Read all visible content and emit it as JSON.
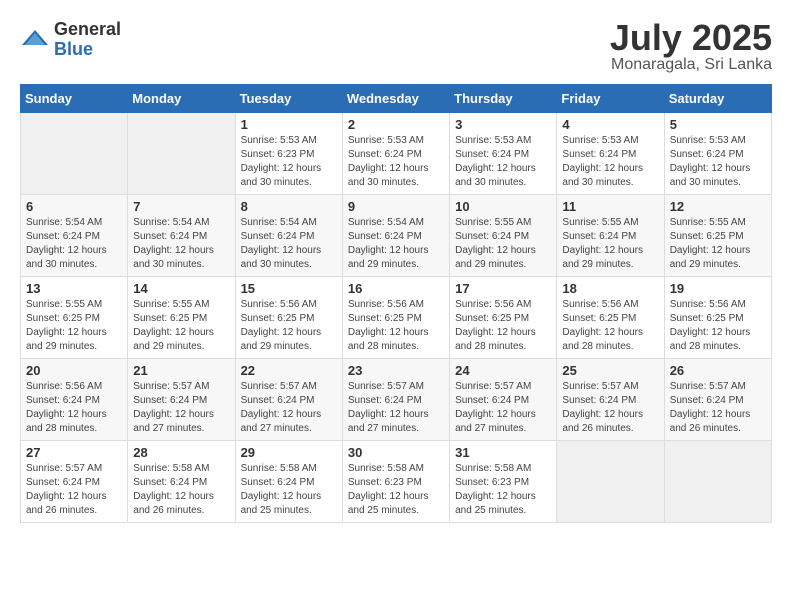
{
  "logo": {
    "general": "General",
    "blue": "Blue"
  },
  "title": "July 2025",
  "location": "Monaragala, Sri Lanka",
  "days_header": [
    "Sunday",
    "Monday",
    "Tuesday",
    "Wednesday",
    "Thursday",
    "Friday",
    "Saturday"
  ],
  "weeks": [
    [
      {
        "day": "",
        "sunrise": "",
        "sunset": "",
        "daylight": ""
      },
      {
        "day": "",
        "sunrise": "",
        "sunset": "",
        "daylight": ""
      },
      {
        "day": "1",
        "sunrise": "Sunrise: 5:53 AM",
        "sunset": "Sunset: 6:23 PM",
        "daylight": "Daylight: 12 hours and 30 minutes."
      },
      {
        "day": "2",
        "sunrise": "Sunrise: 5:53 AM",
        "sunset": "Sunset: 6:24 PM",
        "daylight": "Daylight: 12 hours and 30 minutes."
      },
      {
        "day": "3",
        "sunrise": "Sunrise: 5:53 AM",
        "sunset": "Sunset: 6:24 PM",
        "daylight": "Daylight: 12 hours and 30 minutes."
      },
      {
        "day": "4",
        "sunrise": "Sunrise: 5:53 AM",
        "sunset": "Sunset: 6:24 PM",
        "daylight": "Daylight: 12 hours and 30 minutes."
      },
      {
        "day": "5",
        "sunrise": "Sunrise: 5:53 AM",
        "sunset": "Sunset: 6:24 PM",
        "daylight": "Daylight: 12 hours and 30 minutes."
      }
    ],
    [
      {
        "day": "6",
        "sunrise": "Sunrise: 5:54 AM",
        "sunset": "Sunset: 6:24 PM",
        "daylight": "Daylight: 12 hours and 30 minutes."
      },
      {
        "day": "7",
        "sunrise": "Sunrise: 5:54 AM",
        "sunset": "Sunset: 6:24 PM",
        "daylight": "Daylight: 12 hours and 30 minutes."
      },
      {
        "day": "8",
        "sunrise": "Sunrise: 5:54 AM",
        "sunset": "Sunset: 6:24 PM",
        "daylight": "Daylight: 12 hours and 30 minutes."
      },
      {
        "day": "9",
        "sunrise": "Sunrise: 5:54 AM",
        "sunset": "Sunset: 6:24 PM",
        "daylight": "Daylight: 12 hours and 29 minutes."
      },
      {
        "day": "10",
        "sunrise": "Sunrise: 5:55 AM",
        "sunset": "Sunset: 6:24 PM",
        "daylight": "Daylight: 12 hours and 29 minutes."
      },
      {
        "day": "11",
        "sunrise": "Sunrise: 5:55 AM",
        "sunset": "Sunset: 6:24 PM",
        "daylight": "Daylight: 12 hours and 29 minutes."
      },
      {
        "day": "12",
        "sunrise": "Sunrise: 5:55 AM",
        "sunset": "Sunset: 6:25 PM",
        "daylight": "Daylight: 12 hours and 29 minutes."
      }
    ],
    [
      {
        "day": "13",
        "sunrise": "Sunrise: 5:55 AM",
        "sunset": "Sunset: 6:25 PM",
        "daylight": "Daylight: 12 hours and 29 minutes."
      },
      {
        "day": "14",
        "sunrise": "Sunrise: 5:55 AM",
        "sunset": "Sunset: 6:25 PM",
        "daylight": "Daylight: 12 hours and 29 minutes."
      },
      {
        "day": "15",
        "sunrise": "Sunrise: 5:56 AM",
        "sunset": "Sunset: 6:25 PM",
        "daylight": "Daylight: 12 hours and 29 minutes."
      },
      {
        "day": "16",
        "sunrise": "Sunrise: 5:56 AM",
        "sunset": "Sunset: 6:25 PM",
        "daylight": "Daylight: 12 hours and 28 minutes."
      },
      {
        "day": "17",
        "sunrise": "Sunrise: 5:56 AM",
        "sunset": "Sunset: 6:25 PM",
        "daylight": "Daylight: 12 hours and 28 minutes."
      },
      {
        "day": "18",
        "sunrise": "Sunrise: 5:56 AM",
        "sunset": "Sunset: 6:25 PM",
        "daylight": "Daylight: 12 hours and 28 minutes."
      },
      {
        "day": "19",
        "sunrise": "Sunrise: 5:56 AM",
        "sunset": "Sunset: 6:25 PM",
        "daylight": "Daylight: 12 hours and 28 minutes."
      }
    ],
    [
      {
        "day": "20",
        "sunrise": "Sunrise: 5:56 AM",
        "sunset": "Sunset: 6:24 PM",
        "daylight": "Daylight: 12 hours and 28 minutes."
      },
      {
        "day": "21",
        "sunrise": "Sunrise: 5:57 AM",
        "sunset": "Sunset: 6:24 PM",
        "daylight": "Daylight: 12 hours and 27 minutes."
      },
      {
        "day": "22",
        "sunrise": "Sunrise: 5:57 AM",
        "sunset": "Sunset: 6:24 PM",
        "daylight": "Daylight: 12 hours and 27 minutes."
      },
      {
        "day": "23",
        "sunrise": "Sunrise: 5:57 AM",
        "sunset": "Sunset: 6:24 PM",
        "daylight": "Daylight: 12 hours and 27 minutes."
      },
      {
        "day": "24",
        "sunrise": "Sunrise: 5:57 AM",
        "sunset": "Sunset: 6:24 PM",
        "daylight": "Daylight: 12 hours and 27 minutes."
      },
      {
        "day": "25",
        "sunrise": "Sunrise: 5:57 AM",
        "sunset": "Sunset: 6:24 PM",
        "daylight": "Daylight: 12 hours and 26 minutes."
      },
      {
        "day": "26",
        "sunrise": "Sunrise: 5:57 AM",
        "sunset": "Sunset: 6:24 PM",
        "daylight": "Daylight: 12 hours and 26 minutes."
      }
    ],
    [
      {
        "day": "27",
        "sunrise": "Sunrise: 5:57 AM",
        "sunset": "Sunset: 6:24 PM",
        "daylight": "Daylight: 12 hours and 26 minutes."
      },
      {
        "day": "28",
        "sunrise": "Sunrise: 5:58 AM",
        "sunset": "Sunset: 6:24 PM",
        "daylight": "Daylight: 12 hours and 26 minutes."
      },
      {
        "day": "29",
        "sunrise": "Sunrise: 5:58 AM",
        "sunset": "Sunset: 6:24 PM",
        "daylight": "Daylight: 12 hours and 25 minutes."
      },
      {
        "day": "30",
        "sunrise": "Sunrise: 5:58 AM",
        "sunset": "Sunset: 6:23 PM",
        "daylight": "Daylight: 12 hours and 25 minutes."
      },
      {
        "day": "31",
        "sunrise": "Sunrise: 5:58 AM",
        "sunset": "Sunset: 6:23 PM",
        "daylight": "Daylight: 12 hours and 25 minutes."
      },
      {
        "day": "",
        "sunrise": "",
        "sunset": "",
        "daylight": ""
      },
      {
        "day": "",
        "sunrise": "",
        "sunset": "",
        "daylight": ""
      }
    ]
  ]
}
